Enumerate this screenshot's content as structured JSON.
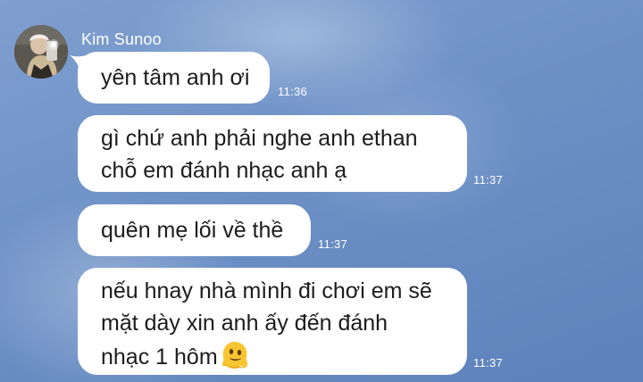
{
  "conversation": {
    "sender_name": "Kim Sunoo",
    "messages": [
      {
        "lines": [
          "yên tâm anh ơi"
        ],
        "time": "11:36"
      },
      {
        "lines": [
          "gì chứ anh phải nghe anh ethan",
          "chỗ em đánh nhạc anh ạ"
        ],
        "time": "11:37"
      },
      {
        "lines": [
          "quên mẹ lối về thề"
        ],
        "time": "11:37"
      },
      {
        "lines": [
          "nếu hnay nhà mình đi chơi em sẽ",
          "mặt dày xin anh ấy đến đánh",
          "nhạc 1 hôm"
        ],
        "time": "11:37",
        "trailing_emoji": "melting-face-emoji"
      }
    ]
  },
  "colors": {
    "bubble": "#ffffff",
    "text": "#1c1c1c",
    "background": "#6d90c5",
    "timestamp": "#ffffff"
  }
}
